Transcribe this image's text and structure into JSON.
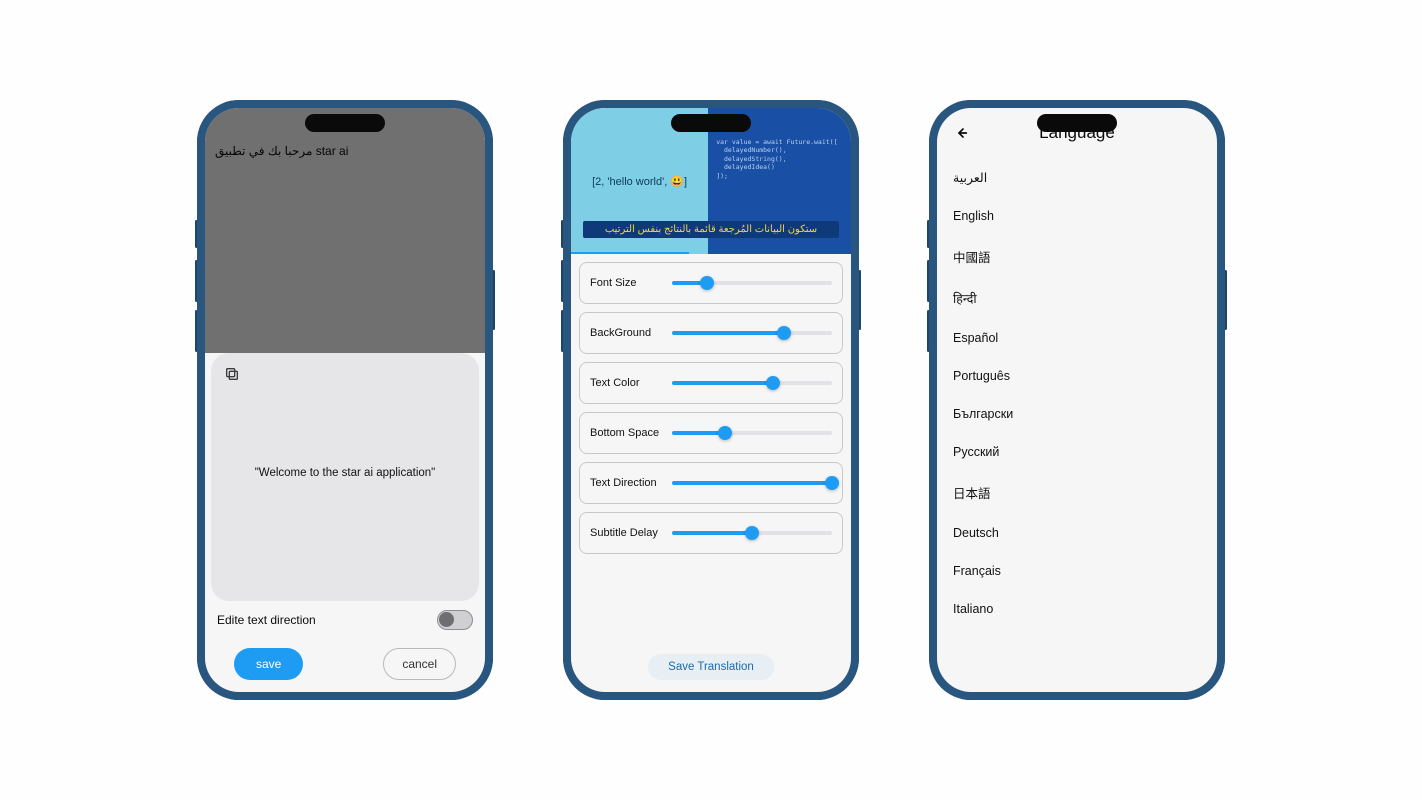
{
  "phone1": {
    "source_text": "مرحبا بك في تطبيق star ai",
    "translated_text": "\"Welcome to the star ai application\"",
    "edit_direction_label": "Edite text direction",
    "save_label": "save",
    "cancel_label": "cancel"
  },
  "phone2": {
    "video": {
      "left_text": "[2, 'hello world', 😃]",
      "code_lines": "var value = await Future.wait([\n  delayedNumber(),\n  delayedString(),\n  delayedIdea()\n]);",
      "subtitle_text": "ستكون البيانات المُرجعة قائمة بالنتائج بنفس الترتيب"
    },
    "sliders": [
      {
        "label": "Font Size",
        "value": 22
      },
      {
        "label": "BackGround",
        "value": 70
      },
      {
        "label": "Text Color",
        "value": 63
      },
      {
        "label": "Bottom Space",
        "value": 33
      },
      {
        "label": "Text Direction",
        "value": 100
      },
      {
        "label": "Subtitle Delay",
        "value": 50
      }
    ],
    "save_label": "Save Translation"
  },
  "phone3": {
    "title": "Language",
    "languages": [
      "العربية",
      "English",
      "中國語",
      "हिन्दी",
      "Español",
      "Português",
      "Български",
      "Русский",
      "日本語",
      "Deutsch",
      "Français",
      "Italiano"
    ]
  }
}
